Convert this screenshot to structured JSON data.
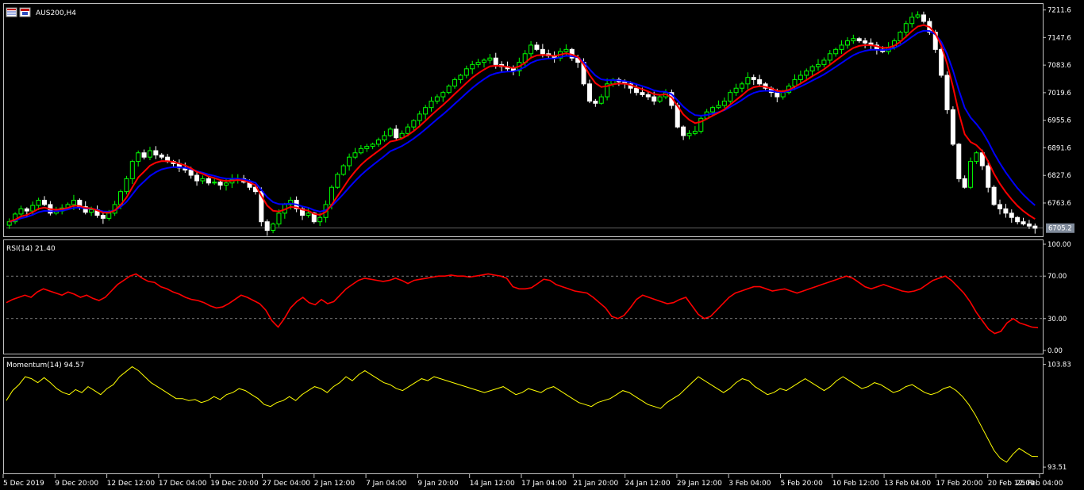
{
  "window": {
    "title": "AUS200,H4"
  },
  "colors": {
    "background": "#000000",
    "frame": "#c0c0c0",
    "bull_candle": "#00ff00",
    "bear_candle": "#ffffff",
    "ma_fast": "#ff0000",
    "ma_slow": "#0000ff",
    "rsi_line": "#ff0000",
    "momentum_line": "#ffff00",
    "price_line": "#c0c0c0",
    "level_line": "#c0c0c0"
  },
  "icons": [
    "chart-window-icon",
    "chart-restore-icon"
  ],
  "chart_data": [
    {
      "type": "candlestick",
      "name": "AUS200,H4",
      "y_axis_ticks": [
        "7211.6",
        "7147.6",
        "7083.6",
        "7019.6",
        "6955.6",
        "6891.6",
        "6827.6",
        "6763.6"
      ],
      "ylim": [
        6690,
        7220
      ],
      "current_price_label": "6705.2",
      "current_price": 6705.2,
      "series": [
        {
          "name": "",
          "values": [
            6720,
            6738,
            6750,
            6745,
            6758,
            6770,
            6760,
            6740,
            6745,
            6752,
            6760,
            6770,
            6755,
            6742,
            6748,
            6735,
            6728,
            6740,
            6760,
            6790,
            6820,
            6860,
            6880,
            6870,
            6885,
            6875,
            6870,
            6860,
            6855,
            6845,
            6840,
            6828,
            6815,
            6820,
            6810,
            6812,
            6805,
            6810,
            6818,
            6820,
            6812,
            6800,
            6790,
            6720,
            6700,
            6715,
            6740,
            6760,
            6770,
            6750,
            6735,
            6740,
            6720,
            6730,
            6760,
            6800,
            6830,
            6850,
            6870,
            6880,
            6890,
            6895,
            6900,
            6910,
            6920,
            6935,
            6915,
            6925,
            6940,
            6955,
            6970,
            6985,
            7000,
            7010,
            7020,
            7035,
            7050,
            7060,
            7075,
            7085,
            7090,
            7095,
            7100,
            7085,
            7080,
            7075,
            7070,
            7090,
            7110,
            7130,
            7120,
            7110,
            7105,
            7100,
            7115,
            7120,
            7100,
            7090,
            7040,
            7000,
            6995,
            7010,
            7040,
            7050,
            7045,
            7040,
            7030,
            7020,
            7015,
            7010,
            7000,
            7010,
            7020,
            6990,
            6940,
            6920,
            6925,
            6930,
            6960,
            6975,
            6985,
            6990,
            7000,
            7020,
            7030,
            7040,
            7055,
            7050,
            7040,
            7030,
            7020,
            7010,
            7020,
            7035,
            7050,
            7060,
            7070,
            7080,
            7085,
            7095,
            7110,
            7120,
            7130,
            7140,
            7145,
            7140,
            7135,
            7130,
            7120,
            7115,
            7125,
            7140,
            7160,
            7180,
            7195,
            7200,
            7185,
            7160,
            7120,
            7060,
            6980,
            6900,
            6820,
            6800,
            6860,
            6880,
            6850,
            6800,
            6760,
            6750,
            6740,
            6730,
            6720,
            6715,
            6710,
            6705
          ]
        }
      ]
    },
    {
      "type": "line",
      "name": "RSI(14) 21.40",
      "y_axis_ticks": [
        "100.00",
        "70.00",
        "30.00",
        "0.00"
      ],
      "ylim": [
        0,
        100
      ],
      "levels": [
        70,
        30
      ],
      "series": [
        {
          "name": "RSI(14)",
          "values": [
            45,
            48,
            50,
            52,
            50,
            55,
            58,
            56,
            54,
            52,
            55,
            53,
            50,
            52,
            49,
            47,
            50,
            56,
            62,
            66,
            70,
            72,
            68,
            65,
            64,
            60,
            58,
            55,
            53,
            50,
            48,
            47,
            45,
            42,
            40,
            41,
            44,
            48,
            52,
            50,
            47,
            44,
            38,
            28,
            22,
            30,
            40,
            46,
            50,
            45,
            43,
            48,
            44,
            46,
            52,
            58,
            62,
            66,
            68,
            67,
            66,
            65,
            66,
            68,
            66,
            63,
            66,
            67,
            68,
            69,
            70,
            70,
            71,
            70,
            70,
            69,
            70,
            71,
            72,
            71,
            70,
            68,
            60,
            58,
            58,
            59,
            63,
            67,
            66,
            62,
            60,
            58,
            56,
            55,
            54,
            50,
            45,
            40,
            32,
            30,
            33,
            40,
            48,
            52,
            50,
            48,
            46,
            44,
            45,
            48,
            50,
            42,
            34,
            30,
            32,
            38,
            44,
            50,
            54,
            56,
            58,
            60,
            60,
            58,
            56,
            57,
            58,
            56,
            54,
            56,
            58,
            60,
            62,
            64,
            66,
            68,
            70,
            68,
            64,
            60,
            58,
            60,
            62,
            60,
            58,
            56,
            55,
            56,
            58,
            62,
            66,
            68,
            70,
            66,
            60,
            54,
            46,
            36,
            28,
            20,
            16,
            18,
            26,
            30,
            26,
            24,
            22,
            21.4
          ]
        }
      ]
    },
    {
      "type": "line",
      "name": "Momentum(14) 94.57",
      "y_axis_ticks": [
        "103.83",
        "93.51"
      ],
      "ylim": [
        93.2,
        104.2
      ],
      "series": [
        {
          "name": "Momentum(14)",
          "values": [
            100.2,
            101.2,
            101.8,
            102.6,
            102.4,
            102.0,
            102.5,
            102.0,
            101.4,
            101.0,
            100.8,
            101.3,
            101.0,
            101.6,
            101.2,
            100.8,
            101.4,
            101.8,
            102.6,
            103.1,
            103.6,
            103.2,
            102.6,
            102.0,
            101.6,
            101.2,
            100.8,
            100.4,
            100.4,
            100.2,
            100.3,
            100.0,
            100.2,
            100.6,
            100.3,
            100.8,
            101.0,
            101.4,
            101.2,
            100.8,
            100.4,
            99.8,
            99.6,
            100.0,
            100.2,
            100.6,
            100.2,
            100.8,
            101.2,
            101.6,
            101.4,
            101.0,
            101.6,
            102.0,
            102.6,
            102.2,
            102.8,
            103.2,
            102.8,
            102.4,
            102.0,
            101.8,
            101.4,
            101.2,
            101.6,
            102.0,
            102.4,
            102.2,
            102.6,
            102.4,
            102.2,
            102.0,
            101.8,
            101.6,
            101.4,
            101.2,
            101.0,
            101.2,
            101.4,
            101.6,
            101.2,
            100.8,
            101.0,
            101.4,
            101.2,
            101.0,
            101.4,
            101.6,
            101.2,
            100.8,
            100.4,
            100.0,
            99.8,
            99.6,
            100.0,
            100.2,
            100.4,
            100.8,
            101.2,
            101.0,
            100.6,
            100.2,
            99.8,
            99.6,
            99.4,
            100.0,
            100.4,
            100.8,
            101.4,
            102.0,
            102.6,
            102.2,
            101.8,
            101.4,
            101.0,
            101.4,
            102.0,
            102.4,
            102.2,
            101.6,
            101.2,
            100.8,
            101.0,
            101.4,
            101.2,
            101.6,
            102.0,
            102.4,
            102.0,
            101.6,
            101.2,
            101.6,
            102.2,
            102.6,
            102.2,
            101.8,
            101.4,
            101.6,
            102.0,
            101.8,
            101.4,
            101.0,
            101.2,
            101.6,
            101.8,
            101.4,
            101.0,
            100.8,
            101.0,
            101.4,
            101.6,
            101.2,
            100.6,
            99.8,
            98.8,
            97.6,
            96.4,
            95.2,
            94.4,
            94.0,
            94.8,
            95.4,
            95.0,
            94.6,
            94.57
          ]
        }
      ]
    }
  ],
  "time_axis": {
    "labels": [
      "5 Dec 2019",
      "9 Dec 20:00",
      "12 Dec 12:00",
      "17 Dec 04:00",
      "19 Dec 20:00",
      "27 Dec 04:00",
      "2 Jan 12:00",
      "7 Jan 04:00",
      "9 Jan 20:00",
      "14 Jan 12:00",
      "17 Jan 04:00",
      "21 Jan 20:00",
      "24 Jan 12:00",
      "29 Jan 12:00",
      "3 Feb 04:00",
      "5 Feb 20:00",
      "10 Feb 12:00",
      "13 Feb 04:00",
      "17 Feb 20:00",
      "20 Feb 12:00",
      "25 Feb 04:00"
    ]
  }
}
